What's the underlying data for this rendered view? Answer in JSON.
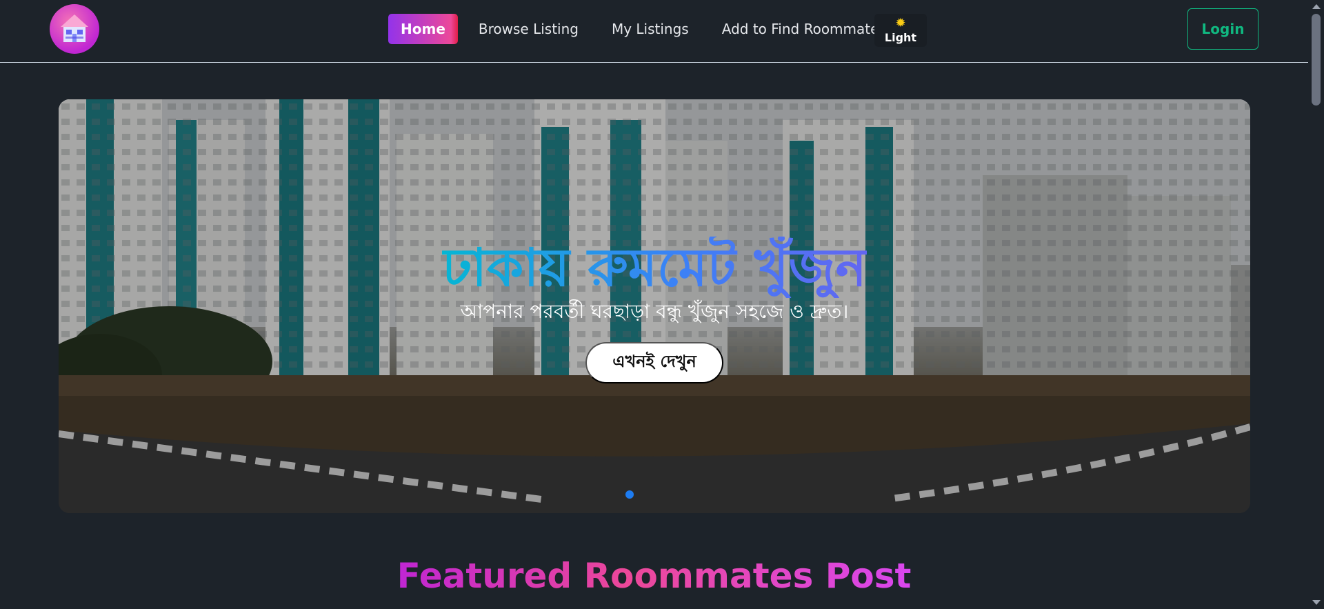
{
  "navbar": {
    "links": [
      {
        "label": "Home",
        "active": true
      },
      {
        "label": "Browse Listing",
        "active": false
      },
      {
        "label": "My Listings",
        "active": false
      },
      {
        "label": "Add to Find Roommate",
        "active": false
      }
    ],
    "theme_toggle": {
      "icon": "sun-icon",
      "label": "Light"
    },
    "login_label": "Login",
    "logo_icon": "house-logo-icon"
  },
  "hero": {
    "title": "ঢাকায় রুমমেট খুঁজুন",
    "subtitle": "আপনার পরবর্তী ঘরছাড়া বন্ধু খুঁজুন সহজে ও দ্রুত।",
    "cta_label": "এখনই দেখুন",
    "slide_count": 1,
    "active_slide": 1
  },
  "featured": {
    "title": "Featured Roommates Post"
  },
  "colors": {
    "background": "#1d232a",
    "accent_active": "#ec4899",
    "login_border": "#10b981",
    "hero_title": "#3b82f6",
    "carousel_dot": "#1d7cf2"
  }
}
